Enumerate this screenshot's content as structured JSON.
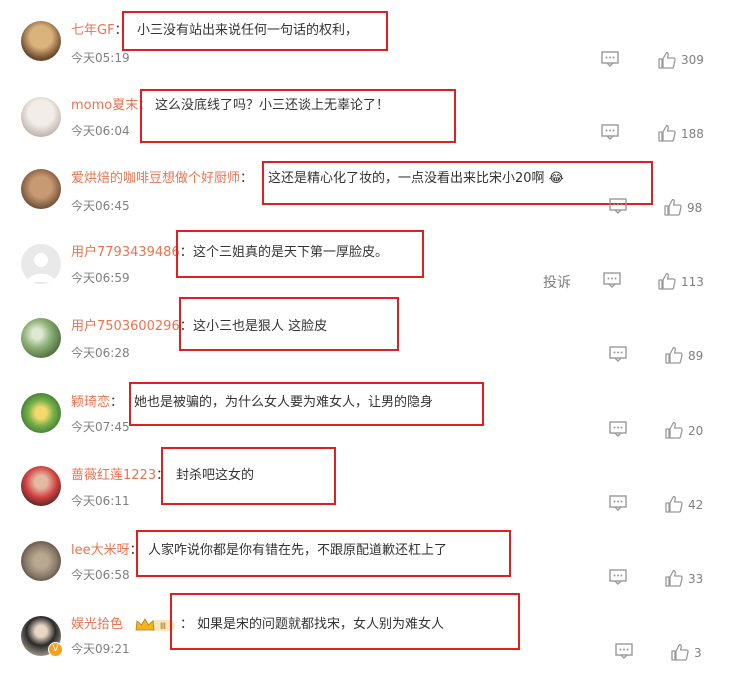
{
  "comments": [
    {
      "user": "七年GF",
      "text": "小三没有站出来说任何一句话的权利，",
      "time": "今天05:19",
      "likes": "309",
      "colors": [
        "#c9a06a",
        "#6b4a2e"
      ]
    },
    {
      "user": "momo夏末",
      "text": "这么没底线了吗？小三还谈上无辜论了！",
      "time": "今天06:04",
      "likes": "188",
      "colors": [
        "#e8e2dc",
        "#b9aca2"
      ]
    },
    {
      "user": "爱烘焙的咖啡豆想做个好厨师",
      "text": "这还是精心化了妆的，一点没看出来比宋小20啊",
      "time": "今天06:45",
      "likes": "98",
      "colors": [
        "#b08060",
        "#6e4b33"
      ]
    },
    {
      "user": "用户7793439486",
      "text": "这个三姐真的是天下第一厚脸皮。",
      "time": "今天06:59",
      "likes": "113",
      "colors": [
        "#e6e6e6",
        "#c7c7c7"
      ]
    },
    {
      "user": "用户7503600296",
      "text": "这小三也是狠人 这脸皮",
      "time": "今天06:28",
      "likes": "89",
      "colors": [
        "#8fb27a",
        "#3e5a2f"
      ]
    },
    {
      "user": "颖琦恋",
      "text": "她也是被骗的，为什么女人要为难女人，让男的隐身",
      "time": "今天07:45",
      "likes": "20",
      "colors": [
        "#7ab04b",
        "#2b6e2b"
      ]
    },
    {
      "user": "蔷薇红莲1223",
      "text": "封杀吧这女的",
      "time": "今天06:11",
      "likes": "42",
      "colors": [
        "#d04040",
        "#3a1f1f"
      ]
    },
    {
      "user": "lee大米呀",
      "text": "人家咋说你都是你有错在先，不跟原配道歉还杠上了",
      "time": "今天06:58",
      "likes": "33",
      "colors": [
        "#8a7a6a",
        "#3e342a"
      ]
    },
    {
      "user": "娱光拾色",
      "text": "如果是宋的问题就都找宋，女人别为难女人",
      "time": "今天09:21",
      "likes": "3",
      "colors": [
        "#2a2a2a",
        "#c9b8a8"
      ]
    }
  ],
  "report_label": "投诉",
  "emoji": "😂",
  "vip_label": "Ⅲ",
  "verified_label": "V",
  "accent": "#eb7350",
  "highlight_color": "#e0201f"
}
